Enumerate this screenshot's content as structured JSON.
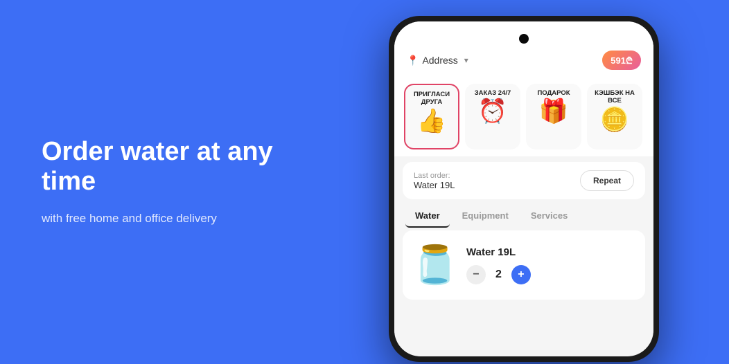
{
  "left": {
    "main_heading": "Order water at any time",
    "sub_heading": "with free home and office delivery",
    "background_color": "#3d6ef5"
  },
  "phone": {
    "top_bar": {
      "address_label": "Address",
      "balance": "591₾"
    },
    "promo_cards": [
      {
        "label": "ПРИГЛАСИ ДРУГА",
        "emoji": "👍"
      },
      {
        "label": "ЗАКАЗ 24/7",
        "emoji": "⏰"
      },
      {
        "label": "ПОДАРОК",
        "emoji": "🎁"
      },
      {
        "label": "КЭШБЭК НА ВСЕ",
        "emoji": "🪙"
      }
    ],
    "last_order": {
      "label": "Last order:",
      "value": "Water 19L",
      "repeat_btn": "Repeat"
    },
    "tabs": [
      {
        "label": "Water",
        "active": true
      },
      {
        "label": "Equipment",
        "active": false
      },
      {
        "label": "Services",
        "active": false
      }
    ],
    "product": {
      "name": "Water 19L",
      "quantity": "2"
    }
  }
}
